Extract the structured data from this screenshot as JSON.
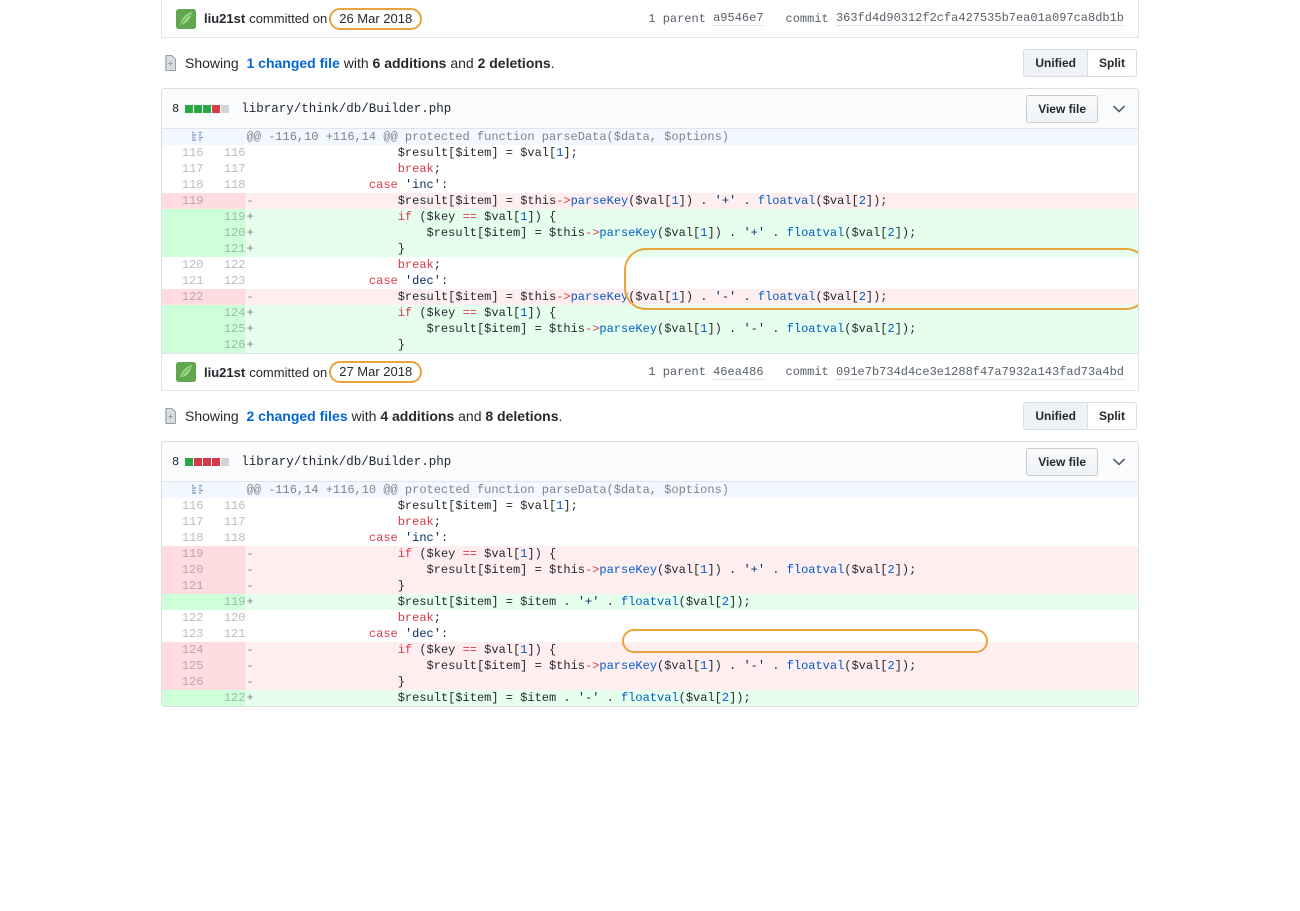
{
  "commits": [
    {
      "avatar_icon": "user-avatar-icon",
      "author": "liu21st",
      "committed_label": "committed on",
      "date": "26 Mar 2018",
      "parent_label": "1 parent",
      "parent_sha": "a9546e7",
      "commit_label": "commit",
      "commit_sha": "363fd4d90312f2cfa427535b7ea01a097ca8db1b"
    },
    {
      "avatar_icon": "user-avatar-icon",
      "author": "liu21st",
      "committed_label": "committed on",
      "date": "27 Mar 2018",
      "parent_label": "1 parent",
      "parent_sha": "46ea486",
      "commit_label": "commit",
      "commit_sha": "091e7b734d4ce3e1288f47a7932a143fad73a4bd"
    }
  ],
  "toolbars": [
    {
      "file_icon": "file-diff-icon",
      "showing": "Showing",
      "changed_files": "1 changed file",
      "with": "with",
      "additions": "6 additions",
      "and": "and",
      "deletions": "2 deletions",
      "period": ".",
      "unified_label": "Unified",
      "split_label": "Split",
      "active_view": "Unified"
    },
    {
      "file_icon": "file-diff-icon",
      "showing": "Showing",
      "changed_files": "2 changed files",
      "with": "with",
      "additions": "4 additions",
      "and": "and",
      "deletions": "8 deletions",
      "period": ".",
      "unified_label": "Unified",
      "split_label": "Split",
      "active_view": "Unified"
    }
  ],
  "files": [
    {
      "stat_count": "8",
      "stat_blocks": [
        "add",
        "add",
        "add",
        "del",
        "non"
      ],
      "path": "library/think/db/Builder.php",
      "view_file_label": "View file",
      "chevron_icon": "chevron-down-icon",
      "hunk_header": "@@ -116,10 +116,14 @@ protected function parseData($data, $options)",
      "rows": [
        {
          "type": "ctx",
          "old": "116",
          "new": "116",
          "marker": "",
          "code": "                    $result[$item] = $val[1];"
        },
        {
          "type": "ctx",
          "old": "117",
          "new": "117",
          "marker": "",
          "code": "                    break;"
        },
        {
          "type": "ctx",
          "old": "118",
          "new": "118",
          "marker": "",
          "code": "                case 'inc':"
        },
        {
          "type": "del",
          "old": "119",
          "new": "",
          "marker": "-",
          "code": "                    $result[$item] = $this->parseKey($val[1]) . '+' . floatval($val[2]);"
        },
        {
          "type": "add",
          "old": "",
          "new": "119",
          "marker": "+",
          "code": "                    if ($key == $val[1]) {"
        },
        {
          "type": "add",
          "old": "",
          "new": "120",
          "marker": "+",
          "code": "                        $result[$item] = $this->parseKey($val[1]) . '+' . floatval($val[2]);"
        },
        {
          "type": "add",
          "old": "",
          "new": "121",
          "marker": "+",
          "code": "                    }"
        },
        {
          "type": "ctx",
          "old": "120",
          "new": "122",
          "marker": "",
          "code": "                    break;"
        },
        {
          "type": "ctx",
          "old": "121",
          "new": "123",
          "marker": "",
          "code": "                case 'dec':"
        },
        {
          "type": "del",
          "old": "122",
          "new": "",
          "marker": "-",
          "code": "                    $result[$item] = $this->parseKey($val[1]) . '-' . floatval($val[2]);"
        },
        {
          "type": "add",
          "old": "",
          "new": "124",
          "marker": "+",
          "code": "                    if ($key == $val[1]) {"
        },
        {
          "type": "add",
          "old": "",
          "new": "125",
          "marker": "+",
          "code": "                        $result[$item] = $this->parseKey($val[1]) . '-' . floatval($val[2]);"
        },
        {
          "type": "add",
          "old": "",
          "new": "126",
          "marker": "+",
          "code": "                    }"
        }
      ]
    },
    {
      "stat_count": "8",
      "stat_blocks": [
        "add",
        "del",
        "del",
        "del",
        "non"
      ],
      "path": "library/think/db/Builder.php",
      "view_file_label": "View file",
      "chevron_icon": "chevron-down-icon",
      "hunk_header": "@@ -116,14 +116,10 @@ protected function parseData($data, $options)",
      "rows": [
        {
          "type": "ctx",
          "old": "116",
          "new": "116",
          "marker": "",
          "code": "                    $result[$item] = $val[1];"
        },
        {
          "type": "ctx",
          "old": "117",
          "new": "117",
          "marker": "",
          "code": "                    break;"
        },
        {
          "type": "ctx",
          "old": "118",
          "new": "118",
          "marker": "",
          "code": "                case 'inc':"
        },
        {
          "type": "del",
          "old": "119",
          "new": "",
          "marker": "-",
          "code": "                    if ($key == $val[1]) {"
        },
        {
          "type": "del",
          "old": "120",
          "new": "",
          "marker": "-",
          "code": "                        $result[$item] = $this->parseKey($val[1]) . '+' . floatval($val[2]);"
        },
        {
          "type": "del",
          "old": "121",
          "new": "",
          "marker": "-",
          "code": "                    }"
        },
        {
          "type": "add",
          "old": "",
          "new": "119",
          "marker": "+",
          "code": "                    $result[$item] = $item . '+' . floatval($val[2]);"
        },
        {
          "type": "ctx",
          "old": "122",
          "new": "120",
          "marker": "",
          "code": "                    break;"
        },
        {
          "type": "ctx",
          "old": "123",
          "new": "121",
          "marker": "",
          "code": "                case 'dec':"
        },
        {
          "type": "del",
          "old": "124",
          "new": "",
          "marker": "-",
          "code": "                    if ($key == $val[1]) {"
        },
        {
          "type": "del",
          "old": "125",
          "new": "",
          "marker": "-",
          "code": "                        $result[$item] = $this->parseKey($val[1]) . '-' . floatval($val[2]);"
        },
        {
          "type": "del",
          "old": "126",
          "new": "",
          "marker": "-",
          "code": "                    }"
        },
        {
          "type": "add",
          "old": "",
          "new": "122",
          "marker": "+",
          "code": "                    $result[$item] = $item . '-' . floatval($val[2]);"
        }
      ]
    }
  ],
  "annotations": {
    "accent_color": "#e8a33d",
    "highlights": [
      {
        "name": "highlight-date-1"
      },
      {
        "name": "highlight-added-block-1"
      },
      {
        "name": "highlight-date-2"
      },
      {
        "name": "highlight-added-line-2"
      }
    ]
  },
  "colors": {
    "addition_bg": "#e6ffed",
    "deletion_bg": "#ffeef0",
    "addition_gutter": "#cdffd8",
    "deletion_gutter": "#ffdce0",
    "hunk_bg": "#f1f8ff",
    "link_blue": "#0366d6"
  }
}
